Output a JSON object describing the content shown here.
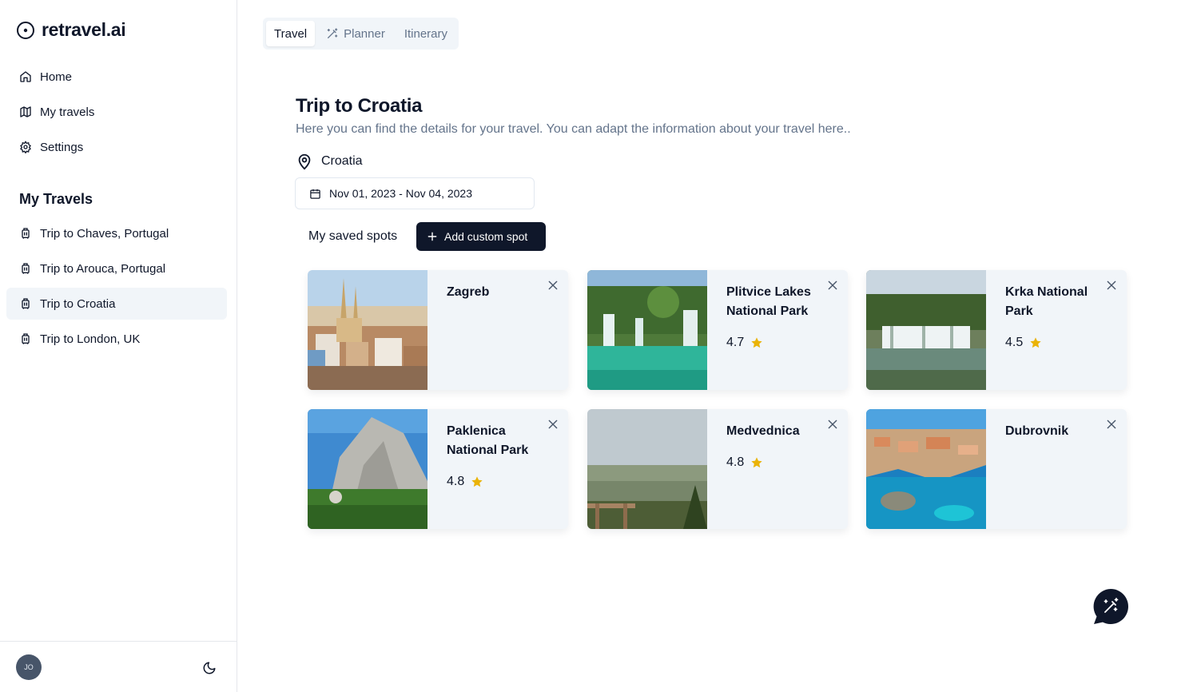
{
  "brand": {
    "name": "retravel.ai"
  },
  "nav": [
    {
      "label": "Home",
      "icon": "home-icon"
    },
    {
      "label": "My travels",
      "icon": "map-icon"
    },
    {
      "label": "Settings",
      "icon": "gear-icon"
    }
  ],
  "sidebar": {
    "section_title": "My Travels",
    "trips": [
      {
        "label": "Trip to Chaves, Portugal",
        "active": false
      },
      {
        "label": "Trip to Arouca, Portugal",
        "active": false
      },
      {
        "label": "Trip to Croatia",
        "active": true
      },
      {
        "label": "Trip to London, UK",
        "active": false
      }
    ],
    "avatar_initials": "JO"
  },
  "tabs": [
    {
      "label": "Travel",
      "active": true
    },
    {
      "label": "Planner",
      "active": false,
      "icon": "magic-wand-icon"
    },
    {
      "label": "Itinerary",
      "active": false
    }
  ],
  "main": {
    "title": "Trip to Croatia",
    "subtitle": "Here you can find the details for your travel. You can adapt the information about your travel here..",
    "location": "Croatia",
    "date_range": "Nov 01, 2023 - Nov 04, 2023",
    "saved_spots_label": "My saved spots",
    "add_button_label": "Add custom spot"
  },
  "spots": [
    {
      "name": "Zagreb",
      "rating": null
    },
    {
      "name": "Plitvice Lakes National Park",
      "rating": "4.7"
    },
    {
      "name": "Krka National Park",
      "rating": "4.5"
    },
    {
      "name": "Paklenica National Park",
      "rating": "4.8"
    },
    {
      "name": "Medvednica",
      "rating": "4.8"
    },
    {
      "name": "Dubrovnik",
      "rating": null
    }
  ],
  "colors": {
    "primary": "#0f172a",
    "muted": "#64748b",
    "card_bg": "#f1f5f9",
    "star": "#eab308"
  }
}
